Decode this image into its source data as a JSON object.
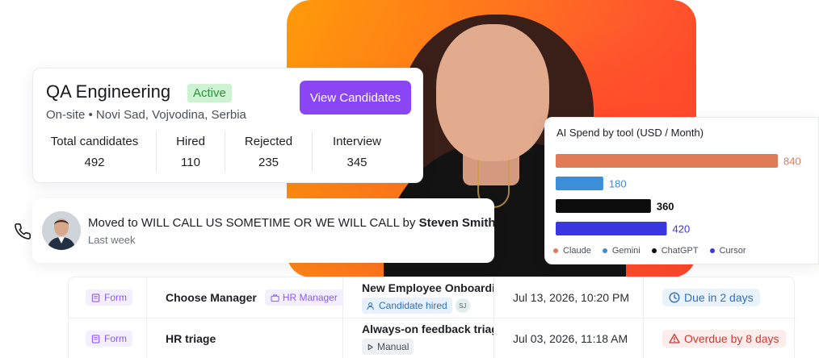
{
  "job": {
    "title": "QA Engineering",
    "status": "Active",
    "location": "On-site • Novi Sad, Vojvodina, Serbia",
    "view_button": "View Candidates",
    "stats": [
      {
        "label": "Total candidates",
        "value": "492"
      },
      {
        "label": "Hired",
        "value": "110"
      },
      {
        "label": "Rejected",
        "value": "235"
      },
      {
        "label": "Interview",
        "value": "345"
      }
    ]
  },
  "activity": {
    "text": "Moved to WILL CALL US SOMETIME OR WE WILL CALL by",
    "actor": "Steven Smith",
    "time": "Last week"
  },
  "chart_data": {
    "type": "bar",
    "title": "AI Spend by tool (USD / Month)",
    "categories": [
      "Claude",
      "Gemini",
      "ChatGPT",
      "Cursor"
    ],
    "values": [
      840,
      180,
      360,
      420
    ],
    "colors": [
      "#e07a57",
      "#3b8ed8",
      "#0c0c0c",
      "#3b37e0"
    ],
    "label_colors": [
      "#e07a57",
      "#3b8ed8",
      "#0c0c0c",
      "#3b37e0"
    ],
    "xlim": [
      0,
      840
    ],
    "legend_position": "bottom",
    "grid": false
  },
  "workflows": [
    {
      "type": "Form",
      "name": "Choose Manager",
      "assignee": "HR Manager",
      "flow": "New Employee Onboarding",
      "flow_chip": "Candidate hired",
      "flow_chip_icon": "user-check-icon",
      "avatar_initials": "SJ",
      "date": "Jul 13, 2026, 10:20 PM",
      "status": "Due in 2 days",
      "status_kind": "due"
    },
    {
      "type": "Form",
      "name": "HR triage",
      "assignee": "",
      "flow": "Always-on feedback triage",
      "flow_chip": "Manual",
      "flow_chip_icon": "play-icon",
      "avatar_initials": "",
      "date": "Jul 03, 2026, 11:18 AM",
      "status": "Overdue by 8 days",
      "status_kind": "overdue"
    }
  ]
}
